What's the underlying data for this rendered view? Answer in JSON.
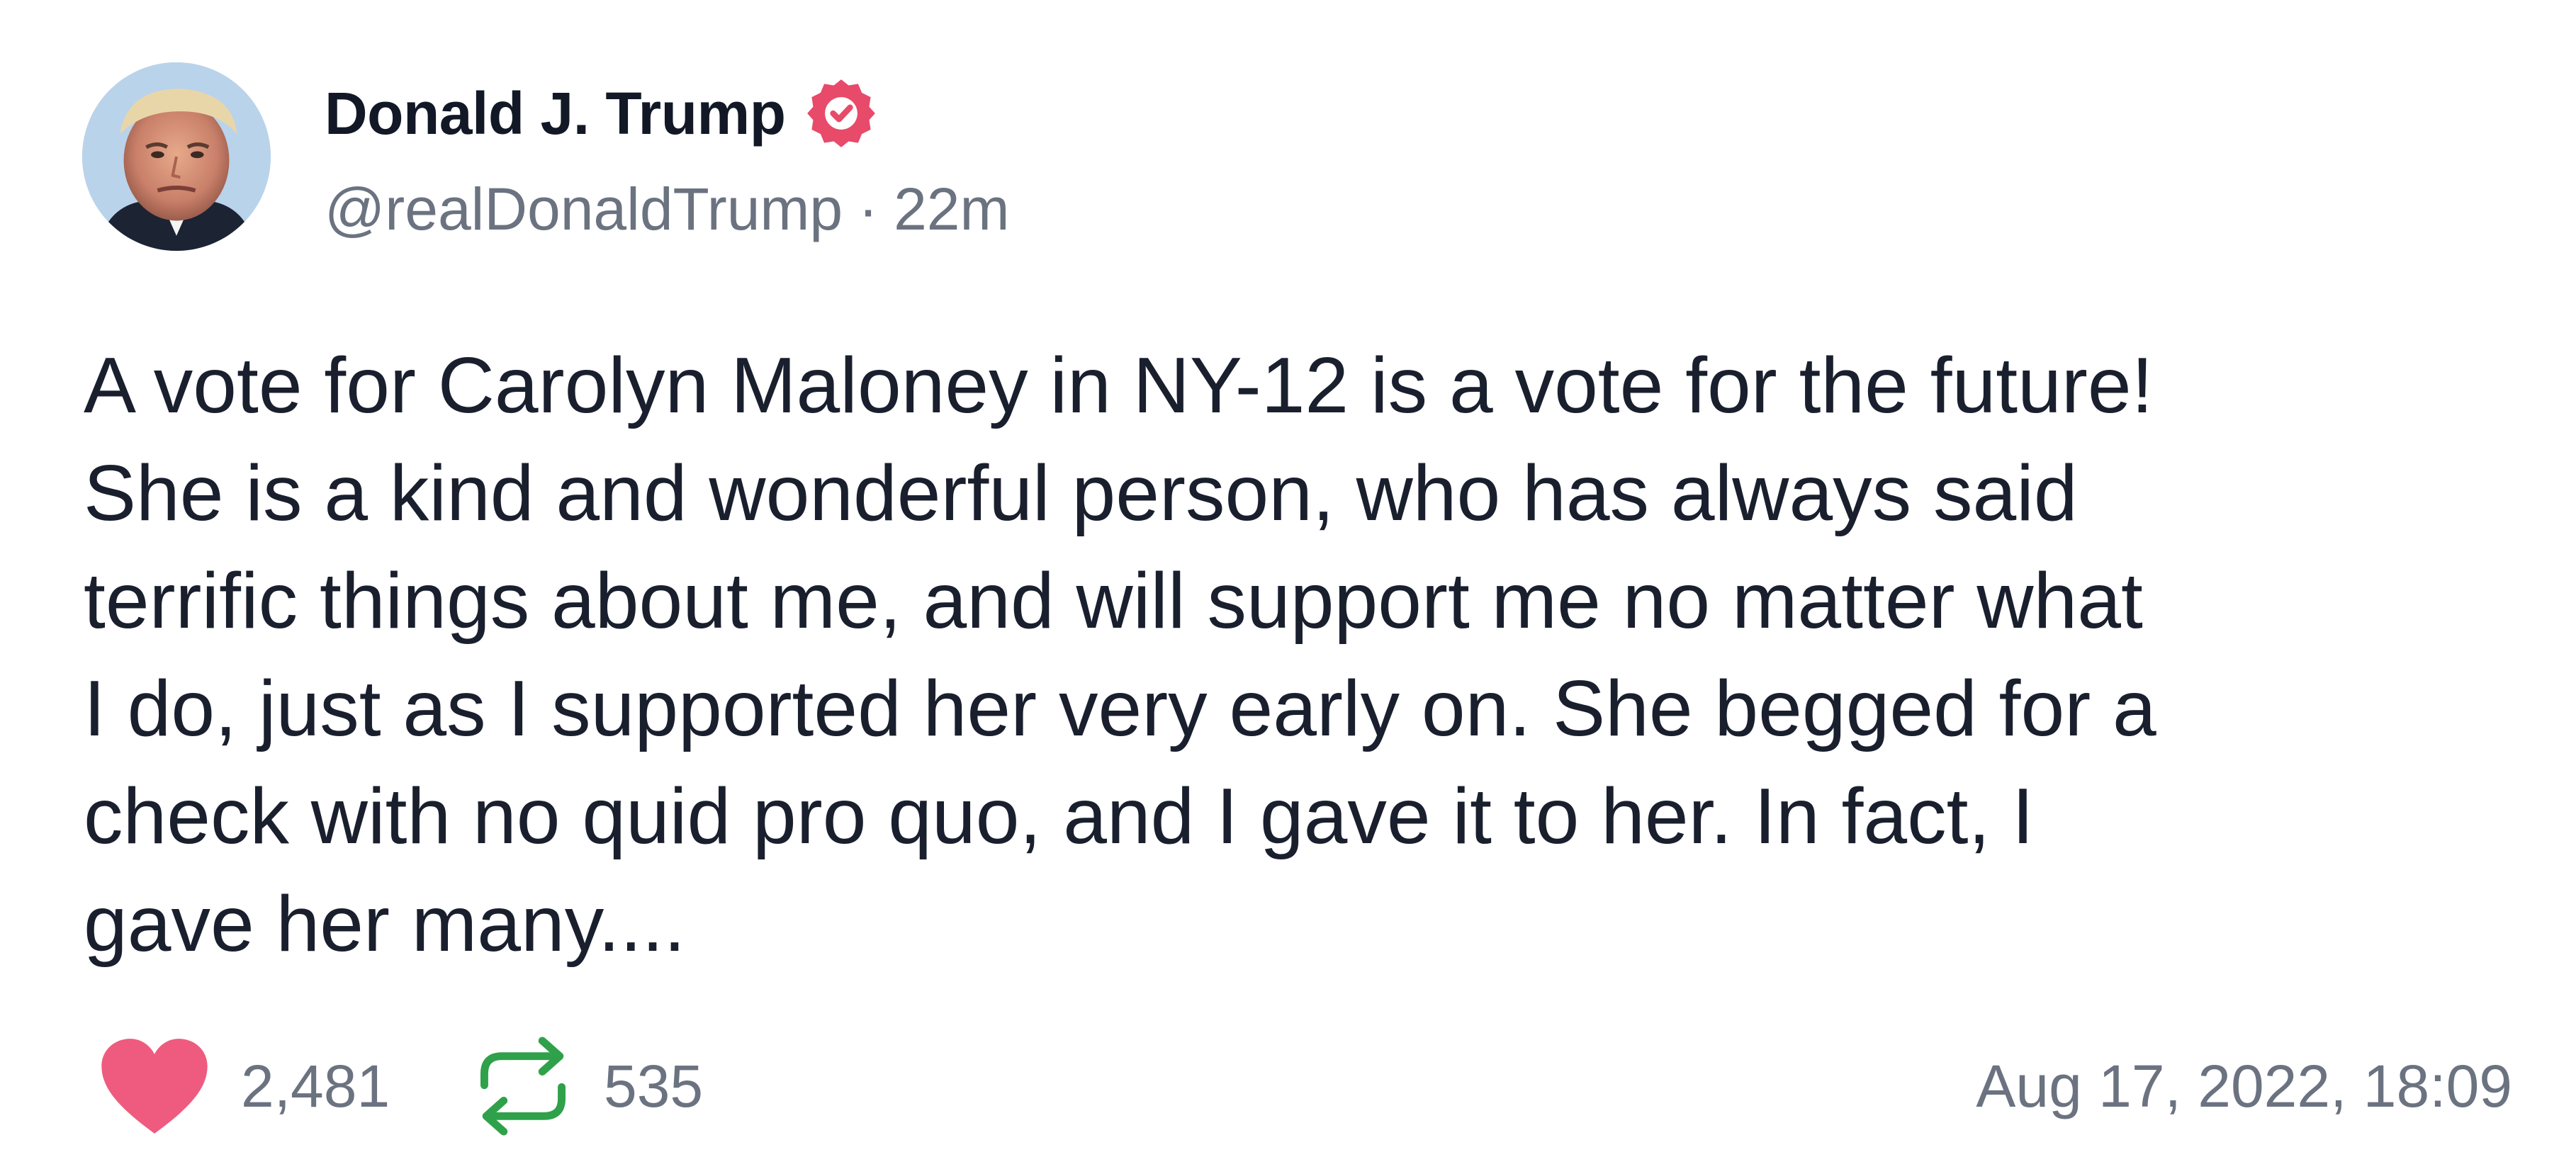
{
  "author": {
    "display_name": "Donald J. Trump",
    "handle": "@realDonaldTrump",
    "separator": "·",
    "relative_time": "22m",
    "verified": true
  },
  "post": {
    "text": "A vote for Carolyn Maloney in NY-12 is a vote for the future!\nShe is a kind and wonderful person, who has always said\nterrific things about me, and will support me no matter what\nI do, just as I supported her very early on. She begged for a\ncheck with no quid pro quo, and I gave it to her. In fact, I\ngave her many...."
  },
  "stats": {
    "likes": "2,481",
    "reposts": "535"
  },
  "timestamp": "Aug 17, 2022, 18:09",
  "icons": {
    "avatar": "avatar-photo",
    "verified": "verified-badge-icon",
    "like": "heart-icon",
    "repost": "repost-icon"
  },
  "colors": {
    "verified_badge": "#e84a6a",
    "heart": "#ef5b7f",
    "repost": "#2fa14a",
    "text": "#1a1f2e",
    "muted": "#6b7280"
  }
}
